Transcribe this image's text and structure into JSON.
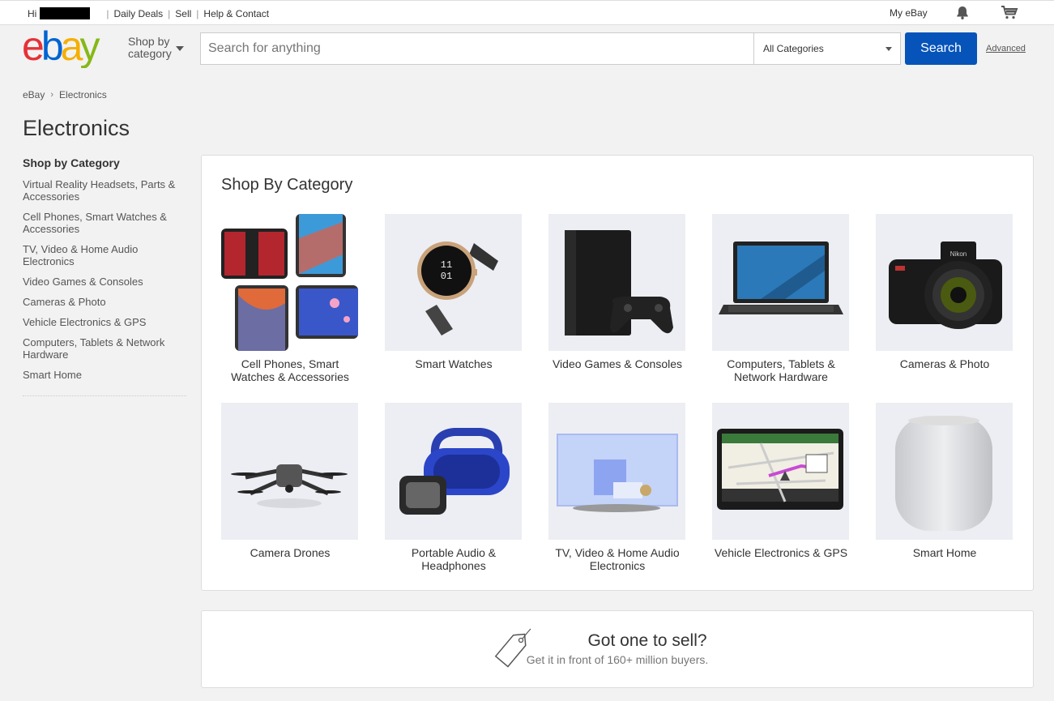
{
  "topbar": {
    "greeting": "Hi",
    "links": [
      "Daily Deals",
      "Sell",
      "Help & Contact"
    ],
    "my_ebay": "My eBay",
    "icons": [
      "bell-icon",
      "cart-icon"
    ]
  },
  "header": {
    "logo_text": "ebay",
    "shop_by_category": "Shop by category",
    "search_placeholder": "Search for anything",
    "category_select": "All Categories",
    "search_button": "Search",
    "advanced": "Advanced"
  },
  "breadcrumb": [
    "eBay",
    "Electronics"
  ],
  "page_title": "Electronics",
  "sidebar": {
    "heading": "Shop by Category",
    "items": [
      "Virtual Reality Headsets, Parts & Accessories",
      "Cell Phones, Smart Watches & Accessories",
      "TV, Video & Home Audio Electronics",
      "Video Games & Consoles",
      "Cameras & Photo",
      "Vehicle Electronics & GPS",
      "Computers, Tablets & Network Hardware",
      "Smart Home"
    ]
  },
  "categories": {
    "title": "Shop By Category",
    "tiles": [
      {
        "label": "Cell Phones, Smart Watches & Accessories",
        "image": "phones"
      },
      {
        "label": "Smart Watches",
        "image": "watch"
      },
      {
        "label": "Video Games & Consoles",
        "image": "console"
      },
      {
        "label": "Computers, Tablets & Network Hardware",
        "image": "laptop"
      },
      {
        "label": "Cameras & Photo",
        "image": "camera"
      },
      {
        "label": "Camera Drones",
        "image": "drone"
      },
      {
        "label": "Portable Audio & Headphones",
        "image": "speaker"
      },
      {
        "label": "TV, Video & Home Audio Electronics",
        "image": "tv"
      },
      {
        "label": "Vehicle Electronics & GPS",
        "image": "gps"
      },
      {
        "label": "Smart Home",
        "image": "homepod"
      }
    ]
  },
  "sell": {
    "title": "Got one to sell?",
    "subtitle": "Get it in front of 160+ million buyers."
  },
  "colors": {
    "search_button": "#0654ba",
    "logo_e": "#e53238",
    "logo_b": "#0064d2",
    "logo_a": "#f5af02",
    "logo_y": "#86b817"
  }
}
